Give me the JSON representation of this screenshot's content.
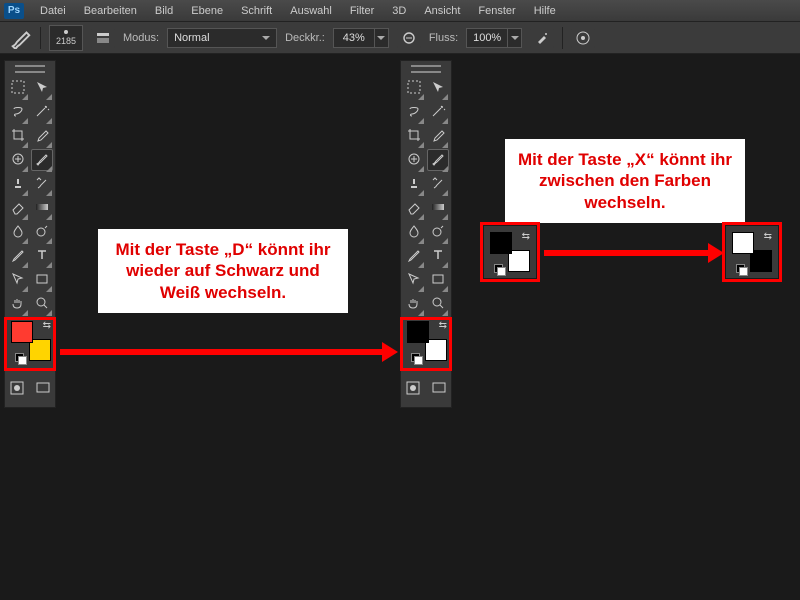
{
  "menubar": {
    "items": [
      "Datei",
      "Bearbeiten",
      "Bild",
      "Ebene",
      "Schrift",
      "Auswahl",
      "Filter",
      "3D",
      "Ansicht",
      "Fenster",
      "Hilfe"
    ]
  },
  "optionsbar": {
    "brush_size": "2185",
    "mode_label": "Modus:",
    "mode_value": "Normal",
    "opacity_label": "Deckkr.:",
    "opacity_value": "43%",
    "flow_label": "Fluss:",
    "flow_value": "100%"
  },
  "toolpanel": {
    "tools": [
      "marquee",
      "move",
      "lasso",
      "magic-wand",
      "crop",
      "eyedropper",
      "healing",
      "brush",
      "stamp",
      "history-brush",
      "eraser",
      "gradient",
      "blur",
      "dodge",
      "pen",
      "type",
      "path-select",
      "rectangle",
      "hand",
      "zoom"
    ]
  },
  "swatches": {
    "left_fg": "#ff3b30",
    "left_bg": "#ffd400",
    "right_fg": "#000000",
    "right_bg": "#ffffff",
    "demo1_fg": "#000000",
    "demo1_bg": "#ffffff",
    "demo2_fg": "#ffffff",
    "demo2_bg": "#000000"
  },
  "callouts": {
    "d_key": "Mit der Taste „D“ könnt ihr wieder auf Schwarz und Weiß wechseln.",
    "x_key": "Mit der Taste „X“ könnt ihr zwischen den Farben wechseln."
  }
}
